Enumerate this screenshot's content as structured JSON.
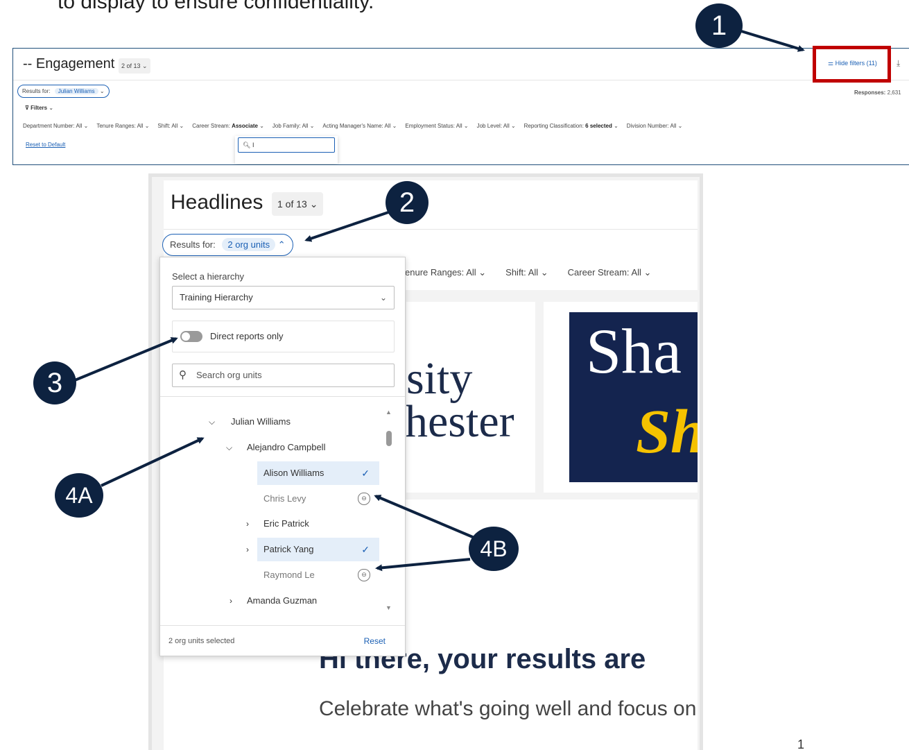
{
  "doc": {
    "caption": "to display to ensure confidentiality."
  },
  "engagement": {
    "title": "-- Engagement",
    "pager": "2 of 13 ⌄",
    "hide_filters": "Hide filters (11)",
    "download_icon": "download-icon",
    "results_label": "Results for:",
    "results_value": "Julian Williams",
    "responses_label": "Responses:",
    "responses_value": "2,631",
    "filters_label": "Filters",
    "filters": [
      {
        "label": "Department Number:",
        "value": "All"
      },
      {
        "label": "Tenure Ranges:",
        "value": "All"
      },
      {
        "label": "Shift:",
        "value": "All"
      },
      {
        "label": "Career Stream:",
        "value": "Associate"
      },
      {
        "label": "Job Family:",
        "value": "All"
      },
      {
        "label": "Acting Manager's Name:",
        "value": "All"
      },
      {
        "label": "Employment Status:",
        "value": "All"
      },
      {
        "label": "Job Level:",
        "value": "All"
      },
      {
        "label": "Reporting Classification:",
        "value": "6 selected"
      },
      {
        "label": "Division Number:",
        "value": "All"
      }
    ],
    "reset_label": "Reset to Default",
    "search_value": "I"
  },
  "headlines": {
    "title": "Headlines",
    "pager": "1 of 13",
    "results_label": "Results for:",
    "results_value": "2 org units",
    "filters": [
      {
        "label": "enure Ranges:",
        "value": "All"
      },
      {
        "label": "Shift:",
        "value": "All"
      },
      {
        "label": "Career Stream:",
        "value": "All"
      }
    ],
    "logo1_line1": "sity",
    "logo1_line2": "hester",
    "logo2_line1": "Sha",
    "logo2_line2": "Sh",
    "hi_text": "Hi there, your results are",
    "celebrate_text": "Celebrate what's going well and focus on"
  },
  "panel": {
    "hierarchy_label": "Select a hierarchy",
    "hierarchy_value": "Training Hierarchy",
    "direct_reports_label": "Direct reports only",
    "search_placeholder": "Search org units",
    "tree": [
      {
        "name": "Julian Williams",
        "toggle": "expanded"
      },
      {
        "name": "Alejandro Campbell",
        "toggle": "expanded"
      },
      {
        "name": "Alison Williams",
        "selected": true
      },
      {
        "name": "Chris Levy",
        "locked": true
      },
      {
        "name": "Eric Patrick",
        "toggle": "collapsed"
      },
      {
        "name": "Patrick Yang",
        "toggle": "collapsed",
        "selected": true
      },
      {
        "name": "Raymond Le",
        "locked": true
      },
      {
        "name": "Amanda Guzman",
        "toggle": "collapsed"
      }
    ],
    "selected_count": "2 org units selected",
    "reset_label": "Reset"
  },
  "callouts": {
    "c1": "1",
    "c2": "2",
    "c3": "3",
    "c4a": "4A",
    "c4b": "4B"
  },
  "page_number": "1",
  "colors": {
    "accent": "#1a5fb4",
    "callout": "#0d2240",
    "highlight_box": "#c00000",
    "selected_row": "#e4eef9"
  }
}
